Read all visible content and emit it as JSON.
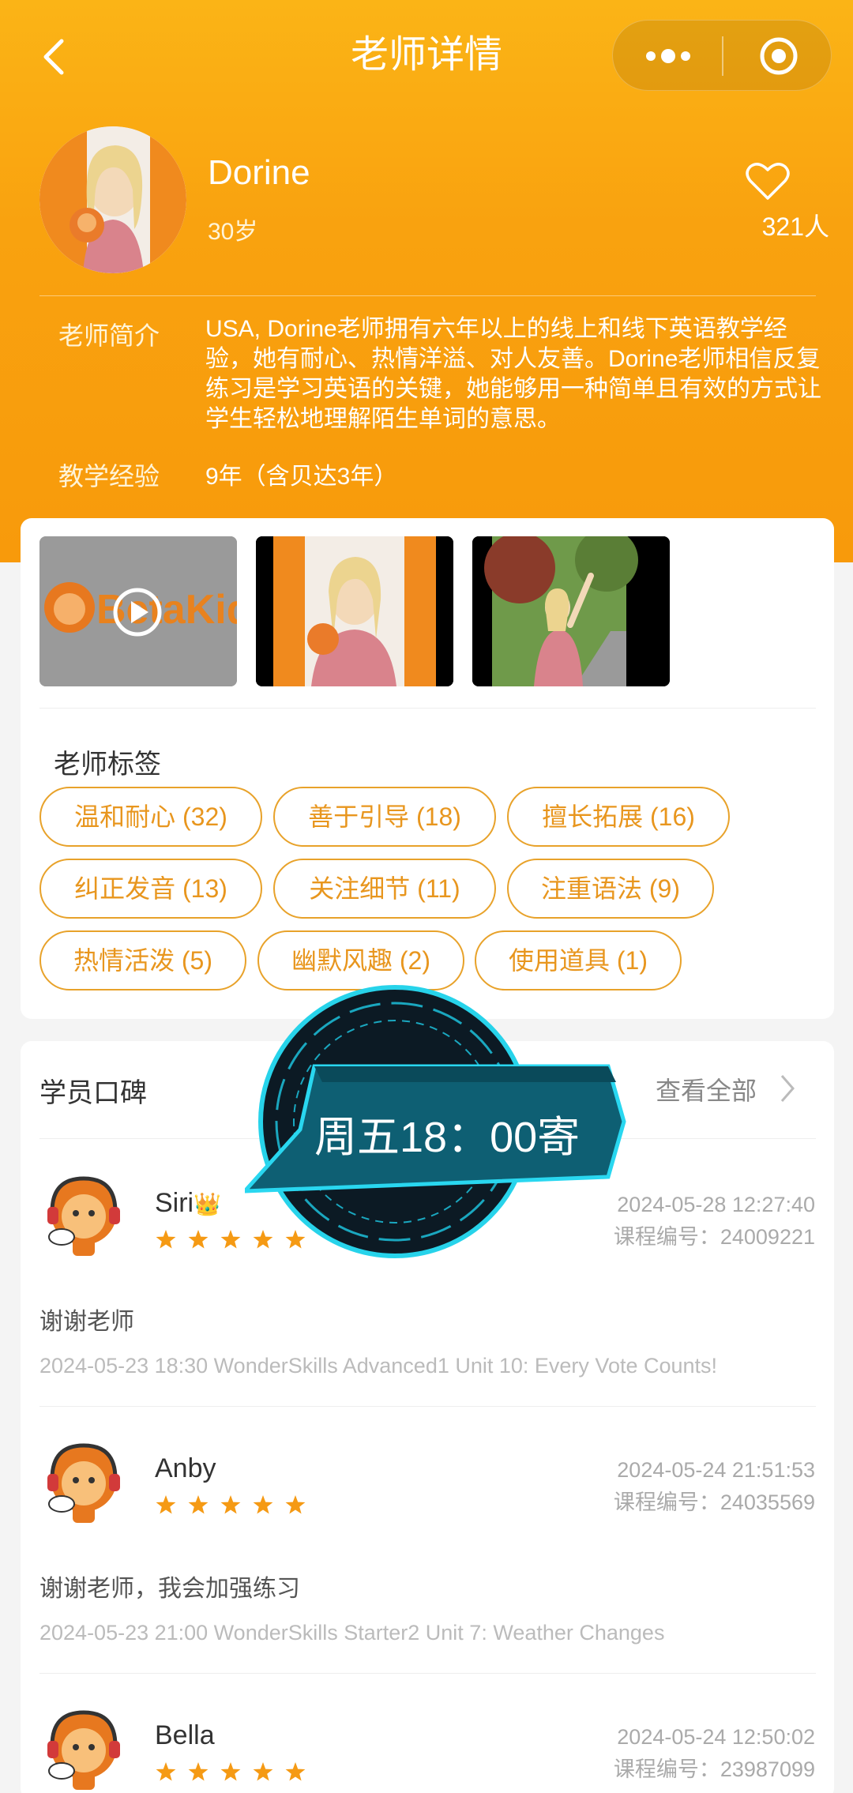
{
  "nav": {
    "title": "老师详情"
  },
  "teacher": {
    "name": "Dorine",
    "age": "30岁",
    "likes": "321人",
    "intro_label": "老师简介",
    "intro": "USA, Dorine老师拥有六年以上的线上和线下英语教学经验，她有耐心、热情洋溢、对人友善。Dorine老师相信反复练习是学习英语的关键，她能够用一种简单且有效的方式让学生轻松地理解陌生单词的意思。",
    "exp_label": "教学经验",
    "exp": "9年（含贝达3年）"
  },
  "media": {
    "video_logo": "BetaKid"
  },
  "tags": {
    "title": "老师标签",
    "items": [
      "温和耐心 (32)",
      "善于引导 (18)",
      "擅长拓展 (16)",
      "纠正发音 (13)",
      "关注细节 (11)",
      "注重语法 (9)",
      "热情活泼 (5)",
      "幽默风趣 (2)",
      "使用道具 (1)"
    ]
  },
  "reviews": {
    "title": "学员口碑",
    "view_all": "查看全部",
    "items": [
      {
        "name": "Siri",
        "badge": "👑",
        "date": "2024-05-28 12:27:40",
        "code": "课程编号：24009221",
        "text": "谢谢老师",
        "meta": "2024-05-23 18:30    WonderSkills Advanced1 Unit 10: Every Vote Counts!",
        "rating": 5
      },
      {
        "name": "Anby",
        "date": "2024-05-24 21:51:53",
        "code": "课程编号：24035569",
        "text": "谢谢老师，我会加强练习",
        "meta": "2024-05-23 21:00    WonderSkills Starter2 Unit 7: Weather Changes",
        "rating": 5
      },
      {
        "name": "Bella",
        "date": "2024-05-24 12:50:02",
        "code": "课程编号：23987099",
        "rating": 5
      }
    ]
  },
  "overlay": {
    "text": "周五18：00寄"
  },
  "colors": {
    "header": "#f9a20f",
    "tag": "#e8a22a",
    "star": "#f59a14"
  }
}
